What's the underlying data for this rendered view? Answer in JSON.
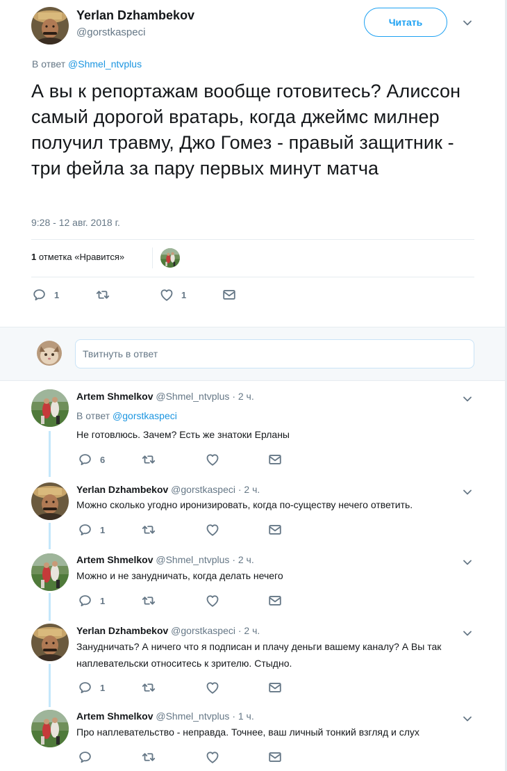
{
  "main_tweet": {
    "author_name": "Yerlan Dzhambekov",
    "author_handle": "@gorstkaspeci",
    "follow_label": "Читать",
    "reply_to_prefix": "В ответ",
    "reply_to_handle": "@Shmel_ntvplus",
    "text": "А вы к репортажам вообще готовитесь? Алиссон самый дорогой вратарь, когда джеймс милнер получил травму, Джо Гомез - правый защитник - три фейла за пару первых минут матча",
    "timestamp": "9:28 - 12 авг. 2018 г.",
    "likes_count": "1",
    "likes_label": "отметка «Нравится»",
    "actions": {
      "replies": "1",
      "retweets": "",
      "likes": "1"
    }
  },
  "reply_box": {
    "placeholder": "Твитнуть в ответ"
  },
  "replies": [
    {
      "name": "Artem Shmelkov",
      "handle": "@Shmel_ntvplus",
      "time": "· 2 ч.",
      "reply_to_prefix": "В ответ",
      "reply_to_handle": "@gorstkaspeci",
      "text": "Не готовлюсь. Зачем? Есть же знатоки Ерланы",
      "reply_count": "6"
    },
    {
      "name": "Yerlan Dzhambekov",
      "handle": "@gorstkaspeci",
      "time": "· 2 ч.",
      "text": "Можно сколько угодно иронизировать, когда по-существу нечего ответить.",
      "reply_count": "1"
    },
    {
      "name": "Artem Shmelkov",
      "handle": "@Shmel_ntvplus",
      "time": "· 2 ч.",
      "text": "Можно и не занудничать, когда делать нечего",
      "reply_count": "1"
    },
    {
      "name": "Yerlan Dzhambekov",
      "handle": "@gorstkaspeci",
      "time": "· 2 ч.",
      "text": "Занудничать? А ничего что я подписан и плачу деньги вашему каналу? А Вы так наплевательски относитесь к зрителю. Стыдно.",
      "reply_count": "1"
    },
    {
      "name": "Artem Shmelkov",
      "handle": "@Shmel_ntvplus",
      "time": "· 1 ч.",
      "text": "Про наплевательство - неправда. Точнее, ваш личный тонкий взгляд и слух",
      "reply_count": ""
    }
  ],
  "icons": {
    "reply": "reply-icon",
    "retweet": "retweet-icon",
    "like": "heart-icon",
    "dm": "envelope-icon",
    "caret": "chevron-down-icon"
  },
  "colors": {
    "accent": "#1da1f2",
    "link": "#1b95e0",
    "muted": "#657786",
    "thread_line": "#c4e7fb"
  }
}
